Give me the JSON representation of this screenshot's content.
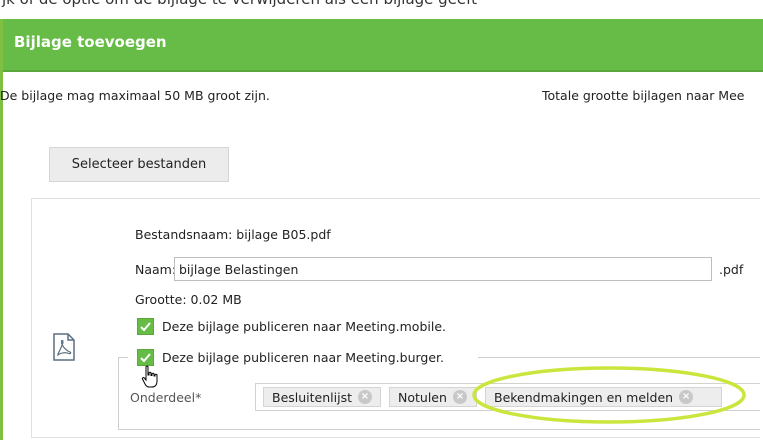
{
  "top_strip_text": "jk of de optie om de bijlage te verwijderen als een bijlage geeft",
  "dialog": {
    "title": "Bijlage toevoegen",
    "limit_text": "De bijlage mag maximaal 50 MB groot zijn.",
    "total_text": "Totale grootte bijlagen naar Mee",
    "select_button": "Selecteer bestanden"
  },
  "file": {
    "icon": "pdf-file-icon",
    "filename_text": "Bestandsnaam: bijlage B05.pdf",
    "name_label": "Naam:",
    "name_value": "bijlage Belastingen",
    "extension": ".pdf",
    "size_text": "Grootte: 0.02 MB",
    "publish_mobile": {
      "label": "Deze bijlage publiceren naar Meeting.mobile.",
      "checked": true
    },
    "publish_burger": {
      "label": "Deze bijlage publiceren naar Meeting.burger.",
      "checked": true
    },
    "onderdeel_label": "Onderdeel*",
    "tags": [
      "Besluitenlijst",
      "Notulen",
      "Bekendmakingen en melden"
    ]
  },
  "colors": {
    "header_green": "#66bc46",
    "highlight": "#c8e63c"
  }
}
